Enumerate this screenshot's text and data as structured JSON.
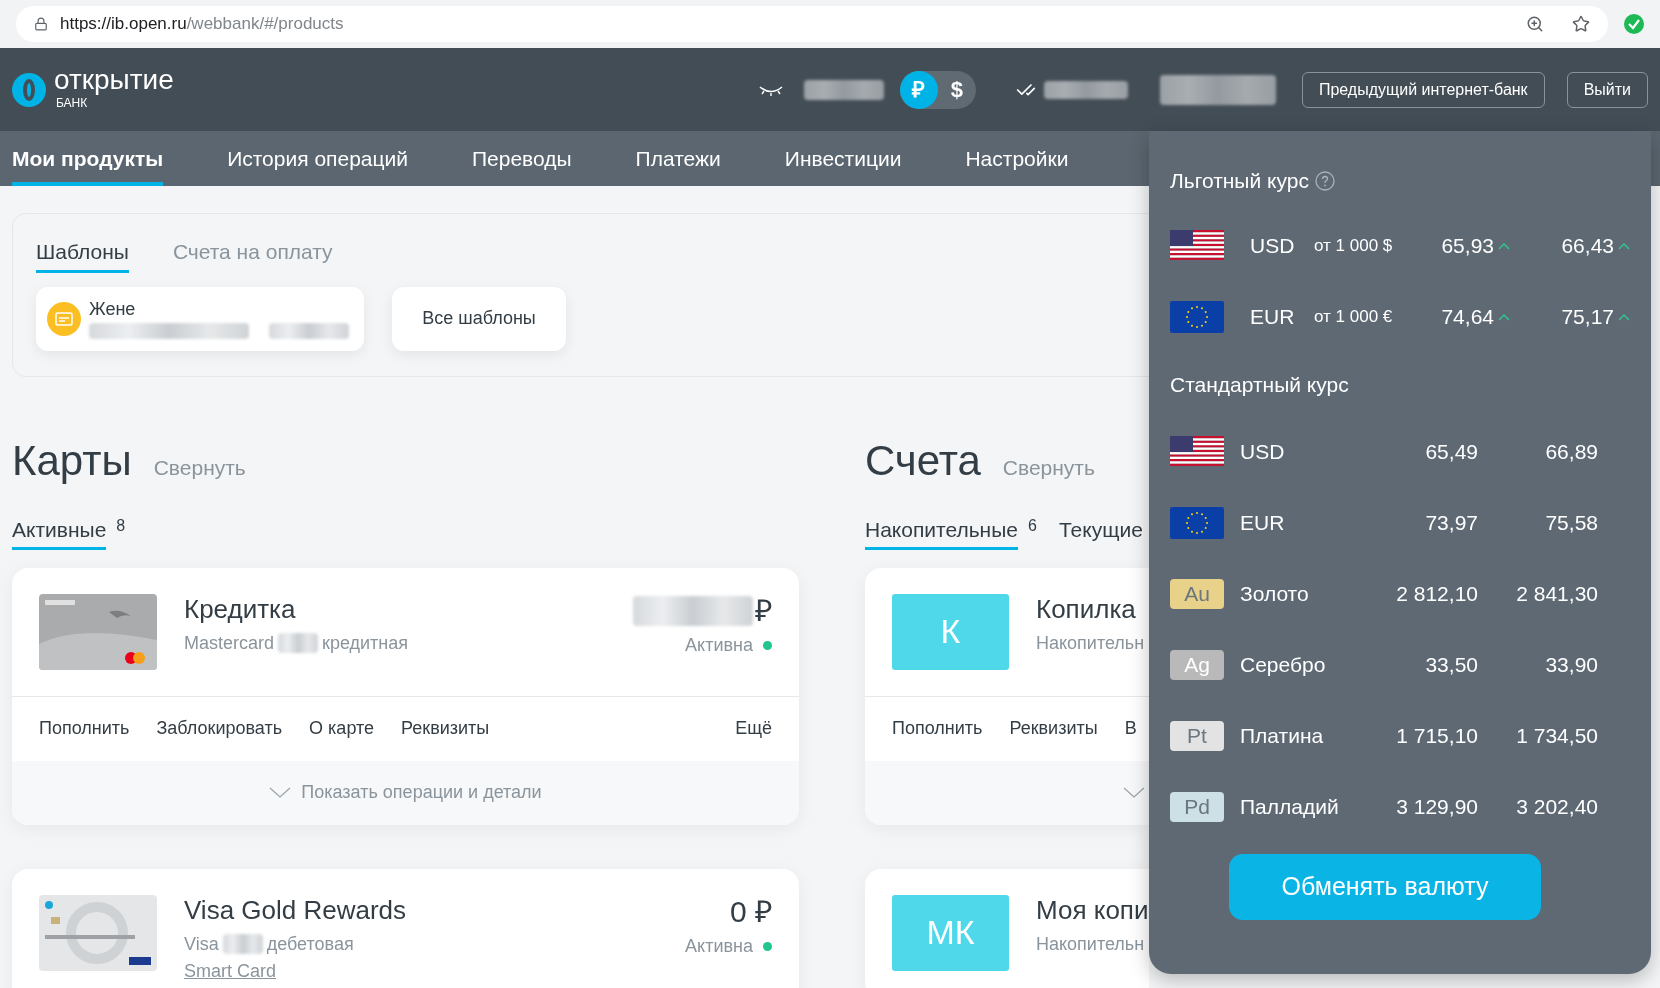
{
  "browser": {
    "url_host": "https://ib.open.ru",
    "url_path": "/webbank/#/products"
  },
  "header": {
    "logo_name": "открытие",
    "logo_sub": "БАНК",
    "currency_toggle": [
      {
        "label": "₽",
        "selected": true
      },
      {
        "label": "$",
        "selected": false
      }
    ],
    "buttons": [
      "Предыдущий интернет-банк",
      "Выйти"
    ]
  },
  "nav": [
    {
      "label": "Мои продукты",
      "selected": true
    },
    {
      "label": "История операций",
      "selected": false
    },
    {
      "label": "Переводы",
      "selected": false
    },
    {
      "label": "Платежи",
      "selected": false
    },
    {
      "label": "Инвестиции",
      "selected": false
    },
    {
      "label": "Настройки",
      "selected": false
    }
  ],
  "templates": {
    "tabs": [
      {
        "label": "Шаблоны",
        "selected": true
      },
      {
        "label": "Счета на оплату",
        "selected": false
      }
    ],
    "items": [
      {
        "name": "Жене"
      }
    ],
    "all_button": "Все шаблоны"
  },
  "cards": {
    "title": "Карты",
    "collapse": "Свернуть",
    "tabs": [
      {
        "label": "Активные",
        "count": "8",
        "selected": true
      }
    ],
    "items": [
      {
        "name": "Кредитка",
        "type": "Mastercard",
        "subtype": "кредитная",
        "balance": "₽",
        "balance_hidden": true,
        "status": "Активна",
        "active": true,
        "actions": [
          "Пополнить",
          "Заблокировать",
          "О карте",
          "Реквизиты"
        ],
        "more": "Ещё",
        "details": "Показать операции и детали"
      },
      {
        "name": "Visa Gold Rewards",
        "type": "Visa",
        "subtype": "дебетовая",
        "link": "Smart Card",
        "balance": "0 ₽",
        "balance_hidden": false,
        "status": "Активна",
        "active": true
      }
    ]
  },
  "accounts": {
    "title": "Счета",
    "collapse": "Свернуть",
    "tabs": [
      {
        "label": "Накопительные",
        "count": "6",
        "selected": true
      },
      {
        "label": "Текущие",
        "selected": false
      }
    ],
    "items": [
      {
        "badge": "К",
        "name": "Копилка",
        "subtitle": "Накопительн",
        "actions": [
          "Пополнить",
          "Реквизиты",
          "В"
        ],
        "expander": true
      },
      {
        "badge": "МК",
        "name": "Моя копи",
        "subtitle": "Накопительн",
        "expander": false
      }
    ]
  },
  "rates": {
    "preferential": {
      "title": "Льготный курс",
      "rows": [
        {
          "kind": "us",
          "code": "USD",
          "threshold": "от 1 000 $",
          "buy": "65,93",
          "buy_up": true,
          "sell": "66,43",
          "sell_up": true
        },
        {
          "kind": "eu",
          "code": "EUR",
          "threshold": "от 1 000 €",
          "buy": "74,64",
          "buy_up": true,
          "sell": "75,17",
          "sell_up": true
        }
      ]
    },
    "standard": {
      "title": "Стандартный курс",
      "rows": [
        {
          "kind": "us",
          "code": "USD",
          "buy": "65,49",
          "sell": "66,89"
        },
        {
          "kind": "eu",
          "code": "EUR",
          "buy": "73,97",
          "sell": "75,58"
        },
        {
          "kind": "metal",
          "badge": "Au",
          "color": "#e8d28a",
          "code": "Золото",
          "buy": "2 812,10",
          "sell": "2 841,30"
        },
        {
          "kind": "metal",
          "badge": "Ag",
          "color": "#b9b9b9",
          "code": "Серебро",
          "buy": "33,50",
          "sell": "33,90"
        },
        {
          "kind": "metal",
          "badge": "Pt",
          "color": "#e3e3e3",
          "code": "Платина",
          "buy": "1 715,10",
          "sell": "1 734,50"
        },
        {
          "kind": "metal",
          "badge": "Pd",
          "color": "#cde0e6",
          "code": "Палладий",
          "buy": "3 129,90",
          "sell": "3 202,40"
        }
      ]
    },
    "exchange_button": "Обменять валюту"
  }
}
